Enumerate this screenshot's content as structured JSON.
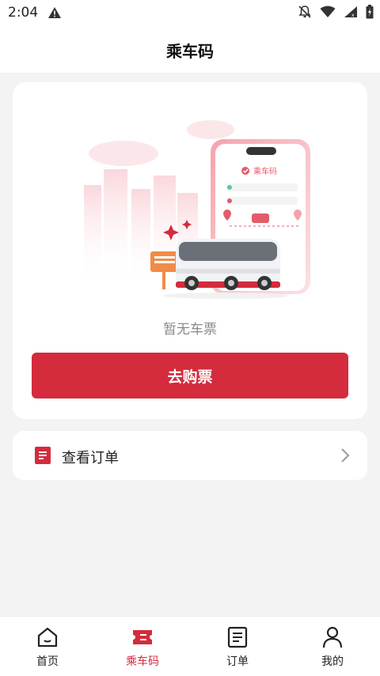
{
  "status_bar": {
    "time": "2:04",
    "icons": [
      "warning-icon",
      "notifications-off-icon",
      "wifi-icon",
      "signal-icon",
      "battery-icon"
    ]
  },
  "header": {
    "title": "乘车码"
  },
  "ticket_card": {
    "illustration": {
      "phone_title": "乘车码"
    },
    "empty_text": "暂无车票",
    "buy_button_label": "去购票"
  },
  "orders_row": {
    "label": "查看订单",
    "icon": "document-icon",
    "chevron": "chevron-right-icon"
  },
  "tabbar": {
    "items": [
      {
        "label": "首页",
        "icon": "home-icon",
        "active": false
      },
      {
        "label": "乘车码",
        "icon": "ticket-icon",
        "active": true
      },
      {
        "label": "订单",
        "icon": "list-icon",
        "active": false
      },
      {
        "label": "我的",
        "icon": "user-icon",
        "active": false
      }
    ]
  },
  "colors": {
    "accent": "#d42b3d",
    "background": "#f3f3f3",
    "card": "#ffffff",
    "muted_text": "#8a8a8a"
  }
}
